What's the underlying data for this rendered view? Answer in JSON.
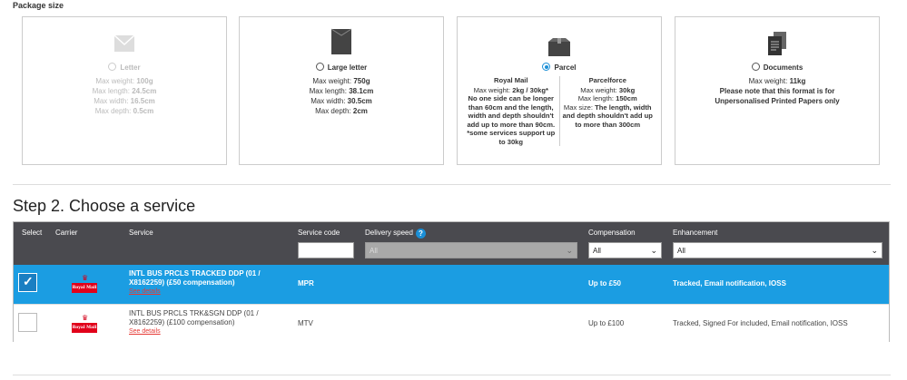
{
  "package_size": {
    "title": "Package size",
    "cards": [
      {
        "label": "Letter",
        "selected": false,
        "disabled": true,
        "icon": "envelope-icon",
        "specs": [
          {
            "k": "Max weight:",
            "v": "100g"
          },
          {
            "k": "Max length:",
            "v": "24.5cm"
          },
          {
            "k": "Max width:",
            "v": "16.5cm"
          },
          {
            "k": "Max depth:",
            "v": "0.5cm"
          }
        ]
      },
      {
        "label": "Large letter",
        "selected": false,
        "disabled": false,
        "icon": "large-envelope-icon",
        "specs": [
          {
            "k": "Max weight:",
            "v": "750g"
          },
          {
            "k": "Max length:",
            "v": "38.1cm"
          },
          {
            "k": "Max width:",
            "v": "30.5cm"
          },
          {
            "k": "Max depth:",
            "v": "2cm"
          }
        ]
      },
      {
        "label": "Parcel",
        "selected": true,
        "disabled": false,
        "icon": "parcel-box-icon",
        "royal_mail": {
          "heading": "Royal Mail",
          "weight_k": "Max weight:",
          "weight_v": "2kg / 30kg*",
          "note": "No one side can be longer than 60cm and the length, width and depth shouldn't add up to more than 90cm. *some services support up to 30kg"
        },
        "parcelforce": {
          "heading": "Parcelforce",
          "weight_k": "Max weight:",
          "weight_v": "30kg",
          "length_k": "Max length:",
          "length_v": "150cm",
          "size_k": "Max size:",
          "size_v": "The length, width and depth shouldn't add up to more than 300cm"
        }
      },
      {
        "label": "Documents",
        "selected": false,
        "disabled": false,
        "icon": "documents-icon",
        "weight_k": "Max weight:",
        "weight_v": "11kg",
        "note": "Please note that this format is for Unpersonalised Printed Papers only"
      }
    ]
  },
  "step2": {
    "title": "Step 2. Choose a service",
    "headers": {
      "select": "Select",
      "carrier": "Carrier",
      "service": "Service",
      "service_code": "Service code",
      "delivery_speed": "Delivery speed",
      "compensation": "Compensation",
      "enhancement": "Enhancement"
    },
    "filters": {
      "service_code": "",
      "delivery_speed": "All",
      "compensation": "All",
      "enhancement": "All"
    },
    "rows": [
      {
        "selected": true,
        "carrier_logo_text": "Royal Mail",
        "service": "INTL BUS PRCLS TRACKED DDP (01 / X8162259) (£50 compensation)",
        "see_details": "See details",
        "code": "MPR",
        "compensation": "Up to £50",
        "enhancement": "Tracked, Email notification, IOSS"
      },
      {
        "selected": false,
        "carrier_logo_text": "Royal Mail",
        "service": "INTL BUS PRCLS TRK&SGN DDP (01 / X8162259) (£100 compensation)",
        "see_details": "See details",
        "code": "MTV",
        "compensation": "Up to £100",
        "enhancement": "Tracked, Signed For included, Email notification, IOSS"
      }
    ]
  },
  "colors": {
    "accent": "#1b9de2",
    "header_bg": "#4a4a4f",
    "link_red": "#e53935"
  }
}
